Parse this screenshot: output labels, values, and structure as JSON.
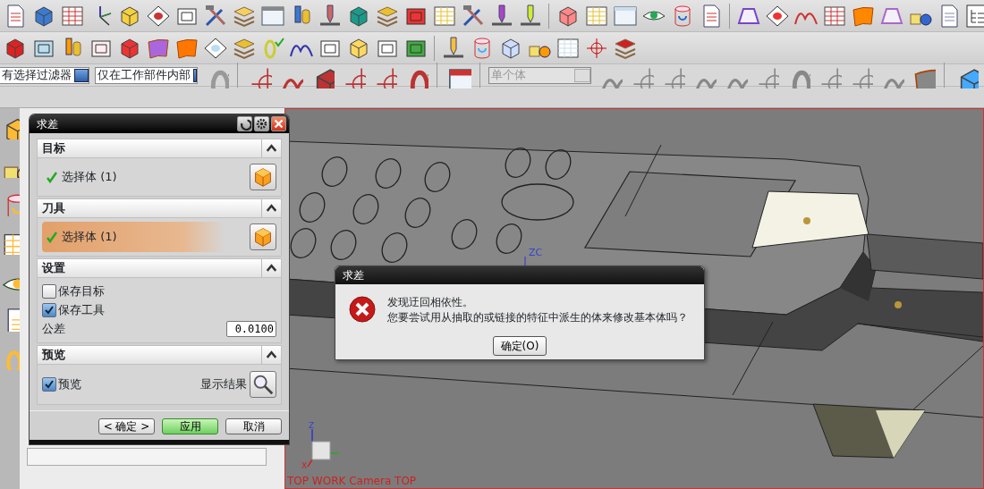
{
  "selection_bar": {
    "type_filter": "有选择过滤器",
    "scope_filter": "仅在工作部件内部",
    "body_filter": {
      "value": "单个体",
      "disabled": true
    }
  },
  "dialog": {
    "title": "求差",
    "sections": [
      {
        "title": "目标",
        "expanded": true,
        "kind": "select",
        "label": "选择体 (1)",
        "selected": false
      },
      {
        "title": "刀具",
        "expanded": true,
        "kind": "select",
        "label": "选择体 (1)",
        "selected": true
      },
      {
        "title": "设置",
        "expanded": true,
        "kind": "settings",
        "options": [
          {
            "label": "保存目标",
            "checked": false
          },
          {
            "label": "保存工具",
            "checked": true
          }
        ],
        "tolerance": {
          "label": "公差",
          "value": "0.0100"
        }
      },
      {
        "title": "预览",
        "expanded": true,
        "kind": "preview",
        "preview": {
          "label": "预览",
          "checked": true
        },
        "show_result": "显示结果"
      }
    ],
    "buttons": [
      {
        "label": "< 确定 >",
        "default": false
      },
      {
        "label": "应用",
        "default": true
      },
      {
        "label": "取消",
        "default": false
      }
    ]
  },
  "viewport": {
    "axis_label": "ZC",
    "triad_labels": [
      "Z",
      "X"
    ],
    "view_label": "TOP WORK Camera TOP"
  },
  "error_dialog": {
    "title": "求差",
    "lines": [
      "发现迂回相依性。",
      "您要尝试用从抽取的或链接的特征中派生的体来修改基本体吗？"
    ],
    "button": "确定(O)"
  }
}
